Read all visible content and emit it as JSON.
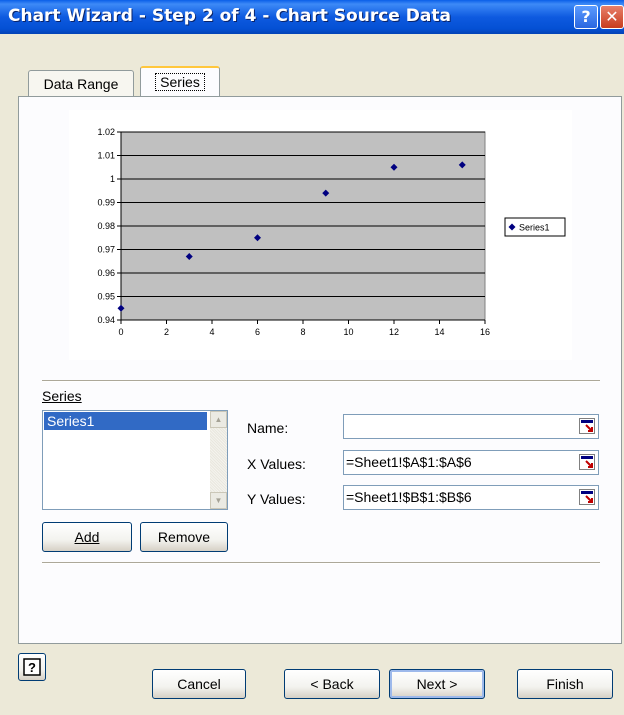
{
  "window": {
    "title": "Chart Wizard - Step 2 of 4 - Chart Source Data",
    "help_glyph": "?",
    "close_glyph": "✕"
  },
  "tabs": [
    {
      "label": "Data Range"
    },
    {
      "label": "Series"
    }
  ],
  "chart_data": {
    "type": "scatter",
    "series": [
      {
        "name": "Series1",
        "x": [
          0,
          3,
          6,
          9,
          12,
          15
        ],
        "y": [
          0.945,
          0.967,
          0.975,
          0.994,
          1.005,
          1.006
        ]
      }
    ],
    "xlim": [
      0,
      16
    ],
    "ylim": [
      0.94,
      1.02
    ],
    "x_ticks": [
      "0",
      "2",
      "4",
      "6",
      "8",
      "10",
      "12",
      "14",
      "16"
    ],
    "y_ticks": [
      "1.02",
      "1.01",
      "1",
      "0.99",
      "0.98",
      "0.97",
      "0.96",
      "0.95",
      "0.94"
    ],
    "grid": true,
    "legend": "right",
    "plot_area_color": "#C0C0C0",
    "marker_color": "#000080"
  },
  "series_section": {
    "label": "Series",
    "items": [
      "Series1"
    ],
    "add_label": "Add",
    "remove_label": "Remove",
    "name_label": "Name:",
    "name_value": "",
    "x_values_label": "X Values:",
    "x_values_value": "=Sheet1!$A$1:$A$6",
    "y_values_label": "Y Values:",
    "y_values_value": "=Sheet1!$B$1:$B$6"
  },
  "footer": {
    "cancel_label": "Cancel",
    "back_label": "< Back",
    "next_label": "Next >",
    "finish_label": "Finish"
  },
  "icons": {
    "help": "help-icon",
    "collapse_dialog": "collapse-dialog-icon",
    "scroll_up": "scroll-up-icon",
    "scroll_down": "scroll-down-icon"
  }
}
